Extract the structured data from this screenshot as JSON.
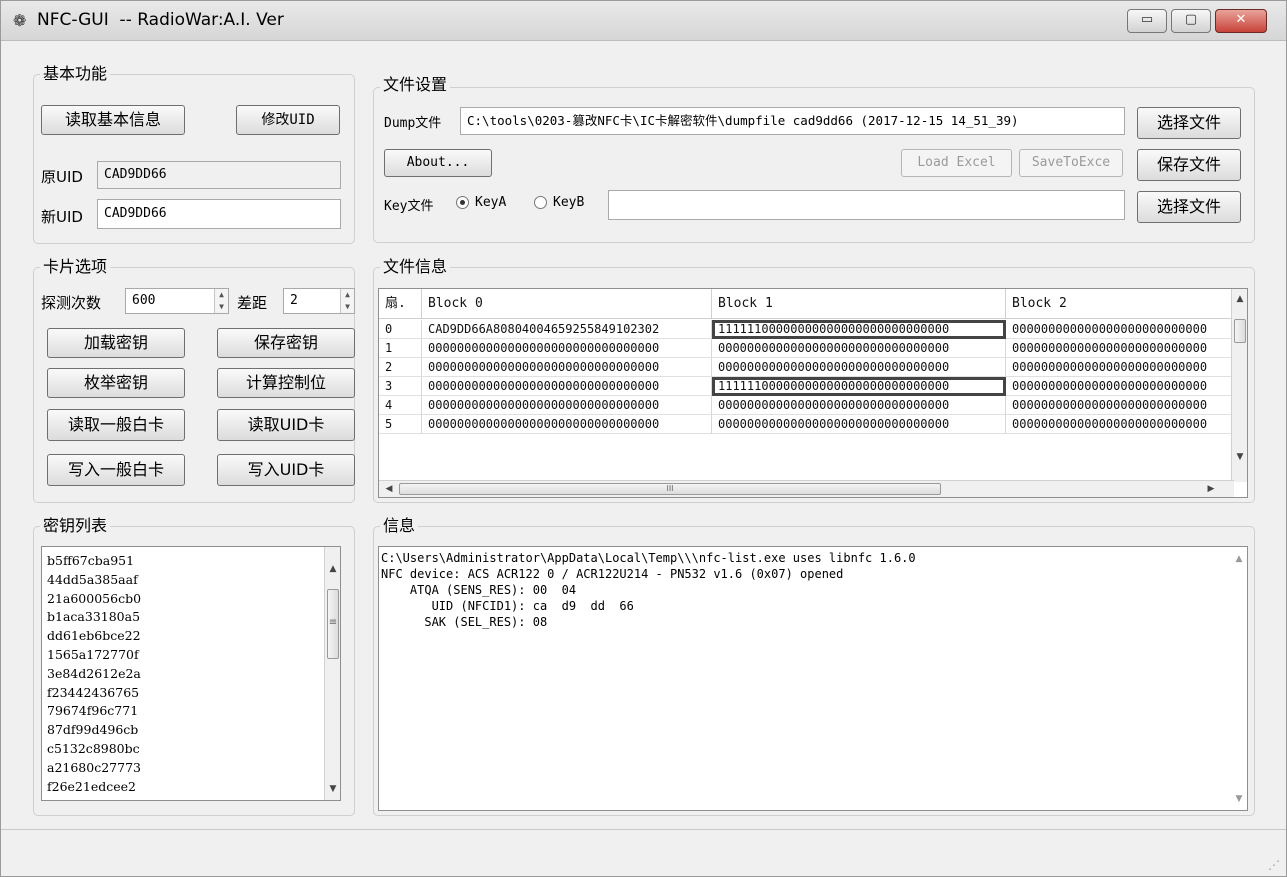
{
  "window": {
    "title": "NFC-GUI  -- RadioWar:A.I. Ver",
    "controls": {
      "minimize": "▭",
      "maximize": "▢",
      "close": "✕"
    }
  },
  "basic": {
    "title": "基本功能",
    "read_info_button": "读取基本信息",
    "modify_uid_button": "修改UID",
    "orig_uid_label": "原UID",
    "orig_uid_value": "CAD9DD66",
    "new_uid_label": "新UID",
    "new_uid_value": "CAD9DD66"
  },
  "file_settings": {
    "title": "文件设置",
    "dump_label": "Dump文件",
    "dump_path": "C:\\tools\\0203-篡改NFC卡\\IC卡解密软件\\dumpfile cad9dd66 (2017-12-15 14_51_39)",
    "choose_file_1": "选择文件",
    "about_button": "About...",
    "load_excel_button": "Load Excel",
    "save_to_excel_button": "SaveToExce",
    "save_file_button": "保存文件",
    "key_label": "Key文件",
    "key_a_label": "KeyA",
    "key_b_label": "KeyB",
    "key_path": "",
    "choose_file_2": "选择文件"
  },
  "card_options": {
    "title": "卡片选项",
    "detect_count_label": "探测次数",
    "detect_count_value": "600",
    "gap_label": "差距",
    "gap_value": "2",
    "load_key_button": "加载密钥",
    "save_key_button": "保存密钥",
    "enumerate_key_button": "枚举密钥",
    "calc_control_button": "计算控制位",
    "read_white_card_button": "读取一般白卡",
    "read_uid_card_button": "读取UID卡",
    "write_white_card_button": "写入一般白卡",
    "write_uid_card_button": "写入UID卡"
  },
  "file_info": {
    "title": "文件信息",
    "columns": [
      "扇.",
      "Block 0",
      "Block 1",
      "Block 2"
    ],
    "rows": [
      [
        "0",
        "CAD9DD66A8080400465925584910230​2",
        "11111100000000000000000000000000",
        "000000000000000000000000000"
      ],
      [
        "1",
        "00000000000000000000000000000000",
        "00000000000000000000000000000000",
        "000000000000000000000000000"
      ],
      [
        "2",
        "00000000000000000000000000000000",
        "00000000000000000000000000000000",
        "000000000000000000000000000"
      ],
      [
        "3",
        "00000000000000000000000000000000",
        "11111100000000000000000000000000",
        "000000000000000000000000000"
      ],
      [
        "4",
        "00000000000000000000000000000000",
        "00000000000000000000000000000000",
        "000000000000000000000000000"
      ],
      [
        "5",
        "00000000000000000000000000000000",
        "00000000000000000000000000000000",
        "000000000000000000000000000"
      ]
    ],
    "hscroll_thumb_glyph": "III"
  },
  "key_list": {
    "title": "密钥列表",
    "items": [
      "b5ff67cba951",
      "44dd5a385aaf",
      "21a600056cb0",
      "b1aca33180a5",
      "dd61eb6bce22",
      "1565a172770f",
      "3e84d2612e2a",
      "f23442436765",
      "79674f96c771",
      "87df99d496cb",
      "c5132c8980bc",
      "a21680c27773",
      "f26e21edcee2"
    ]
  },
  "info": {
    "title": "信息",
    "lines": [
      "C:\\Users\\Administrator\\AppData\\Local\\Temp\\\\\\nfc-list.exe uses libnfc 1.6.0",
      "NFC device: ACS ACR122 0 / ACR122U214 - PN532 v1.6 (0x07) opened",
      "    ATQA (SENS_RES): 00  04",
      "       UID (NFCID1): ca  d9  dd  66",
      "      SAK (SEL_RES): 08"
    ]
  },
  "icons": {
    "app": "app-logo-icon",
    "spin": "spin-arrows-icon",
    "scroll_up": "▲",
    "scroll_down": "▼",
    "scroll_left": "◀",
    "scroll_right": "▶",
    "list_thumb_grip": "≡"
  },
  "colors": {
    "window_bg": "#f0f0f0",
    "highlight_border": "#444444",
    "close_button": "#c8433a"
  }
}
